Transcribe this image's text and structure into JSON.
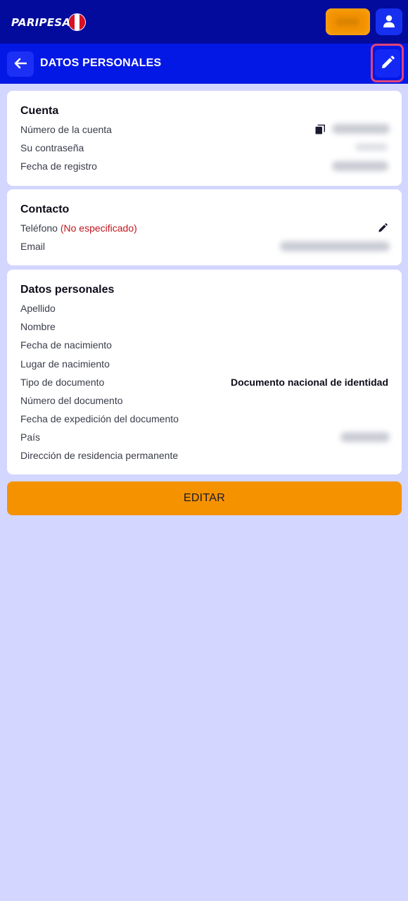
{
  "app": {
    "brand": "PARIPESA",
    "page_title": "DATOS PERSONALES"
  },
  "icons": {
    "user": "user-icon",
    "back": "arrow-left-icon",
    "edit": "pencil-icon",
    "copy": "copy-icon"
  },
  "colors": {
    "topbar": "#020b9b",
    "header": "#0418e5",
    "accent": "#f59200",
    "warning": "#c0161e",
    "background": "#d3d6fe"
  },
  "account": {
    "title": "Cuenta",
    "account_number_label": "Número de la cuenta",
    "password_label": "Su contraseña",
    "registration_date_label": "Fecha de registro"
  },
  "contact": {
    "title": "Contacto",
    "phone_label": "Teléfono",
    "phone_status": "(No especificado)",
    "email_label": "Email"
  },
  "personal": {
    "title": "Datos personales",
    "surname_label": "Apellido",
    "name_label": "Nombre",
    "birth_date_label": "Fecha de nacimiento",
    "birth_place_label": "Lugar de nacimiento",
    "document_type_label": "Tipo de documento",
    "document_type_value": "Documento nacional de identidad",
    "document_number_label": "Número del documento",
    "document_issue_date_label": "Fecha de expedición del documento",
    "country_label": "País",
    "address_label": "Dirección de residencia permanente"
  },
  "actions": {
    "edit_label": "EDITAR"
  }
}
